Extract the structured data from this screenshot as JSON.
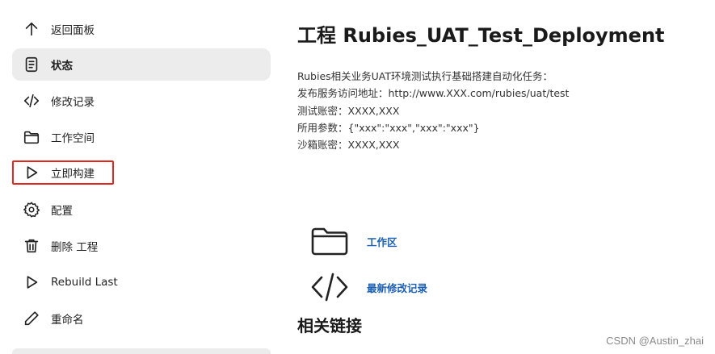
{
  "sidebar": {
    "items": [
      {
        "label": "返回面板",
        "icon": "arrow-up-icon"
      },
      {
        "label": "状态",
        "icon": "document-icon"
      },
      {
        "label": "修改记录",
        "icon": "code-icon"
      },
      {
        "label": "工作空间",
        "icon": "folder-icon"
      },
      {
        "label": "立即构建",
        "icon": "play-icon"
      },
      {
        "label": "配置",
        "icon": "gear-icon"
      },
      {
        "label": "删除 工程",
        "icon": "trash-icon"
      },
      {
        "label": "Rebuild Last",
        "icon": "play-icon"
      },
      {
        "label": "重命名",
        "icon": "pencil-icon"
      }
    ],
    "active_item": "状态",
    "highlight_color": "#e0281f"
  },
  "main": {
    "title": "工程 Rubies_UAT_Test_Deployment",
    "description": [
      "Rubies相关业务UAT环境测试执行基础搭建自动化任务：",
      "发布服务访问地址：http://www.XXX.com/rubies/uat/test",
      "测试账密：XXXX,XXX",
      "所用参数：{\"xxx\":\"xxx\",\"xxx\":\"xxx\"}",
      "沙箱账密：XXXX,XXX"
    ],
    "links": [
      {
        "label": "工作区",
        "icon": "folder-icon"
      },
      {
        "label": "最新修改记录",
        "icon": "code-icon"
      }
    ],
    "section_title": "相关链接"
  },
  "watermark": "CSDN @Austin_zhai",
  "colors": {
    "link": "#1a5fb4",
    "active_bg": "#ececec"
  }
}
